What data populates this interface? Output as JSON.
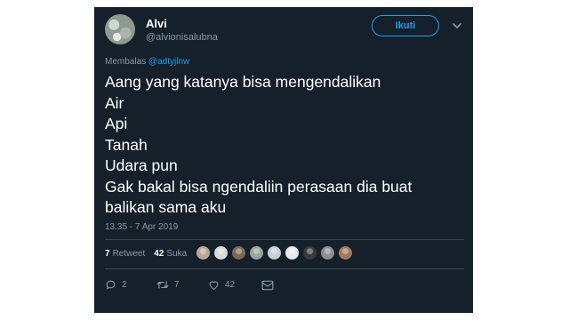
{
  "tweet": {
    "display_name": "Alvi",
    "handle": "@alvionisalubna",
    "follow_label": "Ikuti",
    "reply_prefix": "Membalas",
    "reply_mention": "@adtyjlnw",
    "text_lines": [
      "Aang yang katanya bisa mengendalikan",
      "Air",
      "Api",
      "Tanah",
      "Udara pun",
      "Gak bakal bisa ngendaliin perasaan dia buat",
      "balikan sama aku"
    ],
    "timestamp": "13.35 - 7 Apr 2019",
    "retweet_count": "7",
    "retweet_label": "Retweet",
    "like_count": "42",
    "like_label": "Suka",
    "liker_avatar_colors": [
      "#b8a89a",
      "#d9d9d9",
      "#7a6a55",
      "#9aa59a",
      "#c7cfd6",
      "#e8e8e8",
      "#3a3a3a",
      "#8a8f94",
      "#a07a60"
    ],
    "actions": {
      "reply_count": "2",
      "retweet_count": "7",
      "like_count": "42"
    }
  },
  "colors": {
    "background": "#15202b",
    "accent": "#1da1f2",
    "muted": "#8899a6",
    "divider": "#38444d"
  },
  "icons": [
    "chevron-down-icon",
    "reply-icon",
    "retweet-icon",
    "like-icon",
    "message-icon"
  ]
}
